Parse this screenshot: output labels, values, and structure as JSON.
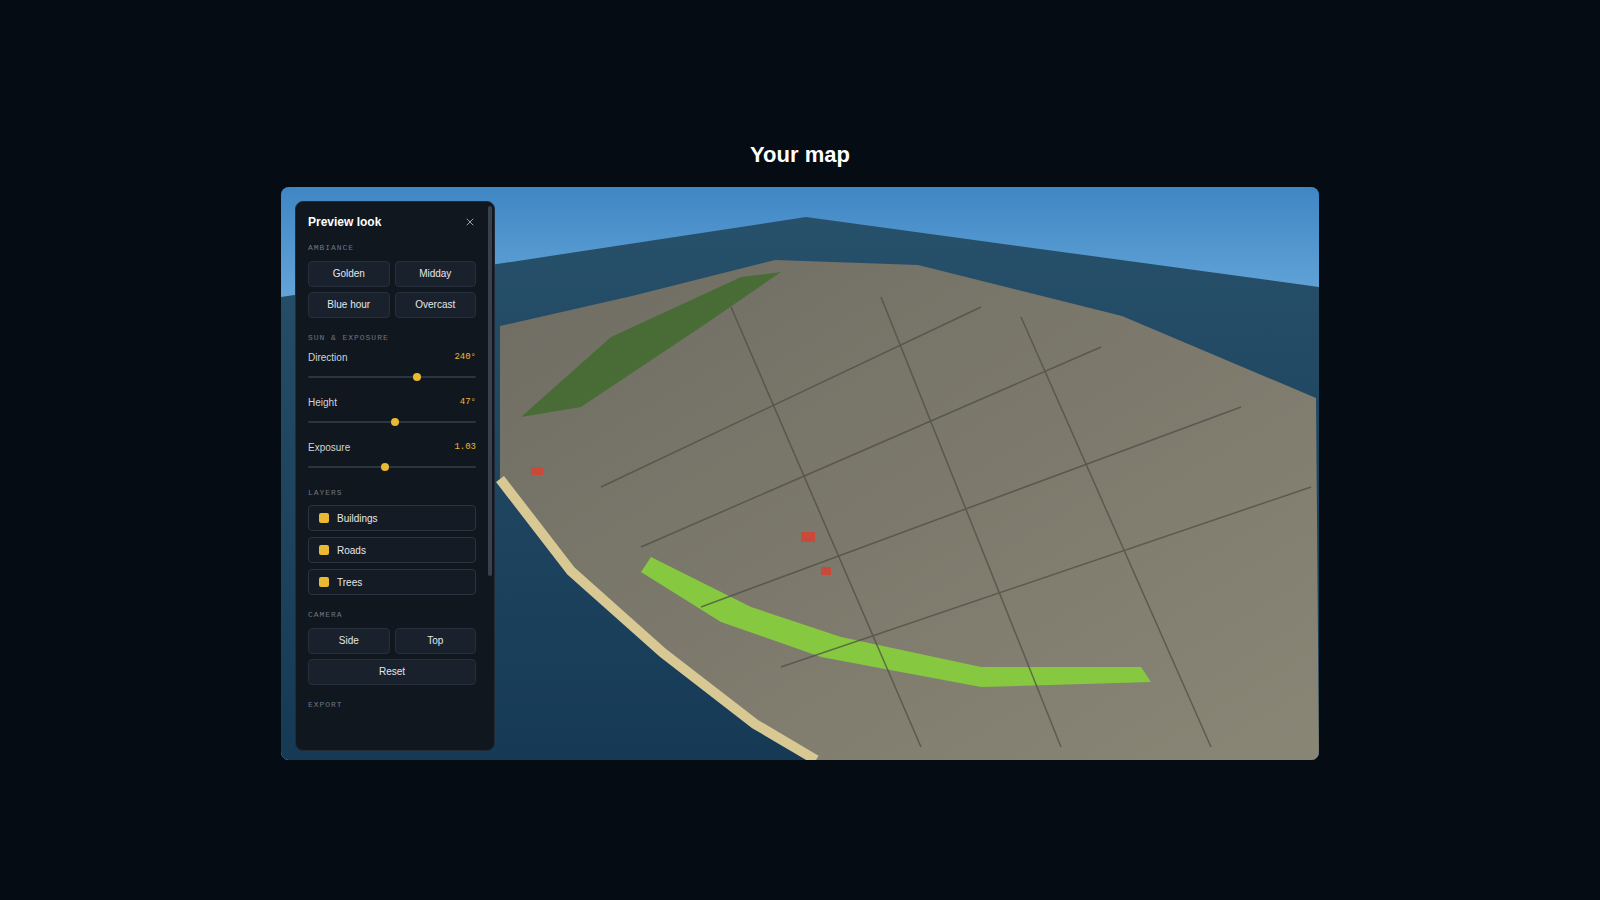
{
  "page": {
    "title": "Your map"
  },
  "panel": {
    "title": "Preview look",
    "ambiance": {
      "label": "AMBIANCE",
      "options": [
        {
          "label": "Golden",
          "selected": false
        },
        {
          "label": "Midday",
          "selected": false
        },
        {
          "label": "Blue hour",
          "selected": false
        },
        {
          "label": "Overcast",
          "selected": false
        }
      ]
    },
    "sun": {
      "label": "SUN & EXPOSURE",
      "sliders": [
        {
          "name": "Direction",
          "reading": "240°",
          "level": 0.65
        },
        {
          "name": "Height",
          "reading": "47°",
          "level": 0.52
        },
        {
          "name": "Exposure",
          "reading": "1.03",
          "level": 0.46
        }
      ]
    },
    "layers": {
      "label": "LAYERS",
      "items": [
        {
          "name": "Buildings",
          "checked": true
        },
        {
          "name": "Roads",
          "checked": true
        },
        {
          "name": "Trees",
          "checked": true
        }
      ]
    },
    "camera": {
      "label": "CAMERA",
      "buttons": [
        "Side",
        "Top"
      ],
      "reset": "Reset"
    },
    "export": {
      "label": "EXPORT"
    }
  }
}
